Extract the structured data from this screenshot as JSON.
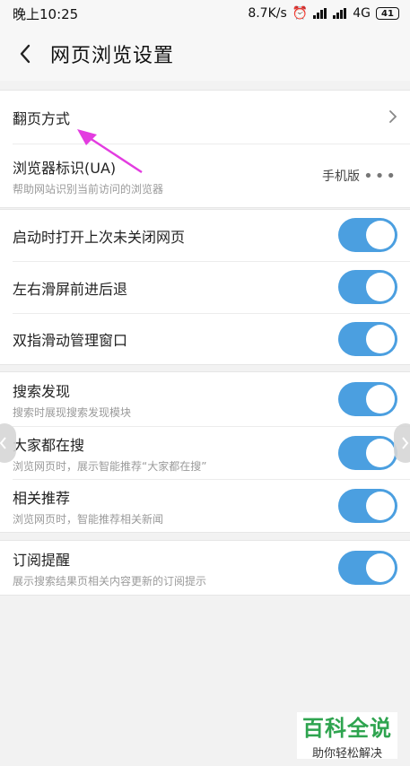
{
  "status": {
    "time": "晚上10:25",
    "speed": "8.7K/s",
    "network": "4G",
    "battery": "41",
    "icons": [
      "alarm-icon",
      "signal-icon",
      "signal-icon",
      "battery-icon"
    ]
  },
  "header": {
    "title": "网页浏览设置",
    "back_icon": "chevron-left-icon"
  },
  "section1": {
    "page_turn": {
      "label": "翻页方式"
    },
    "ua": {
      "label": "浏览器标识(UA)",
      "desc": "帮助网站识别当前访问的浏览器",
      "value": "手机版",
      "more": "•••"
    }
  },
  "section2": {
    "items": [
      {
        "label": "启动时打开上次未关闭网页",
        "on": true
      },
      {
        "label": "左右滑屏前进后退",
        "on": true
      },
      {
        "label": "双指滑动管理窗口",
        "on": true
      }
    ]
  },
  "section3": {
    "items": [
      {
        "label": "搜索发现",
        "desc": "搜索时展现搜索发现模块",
        "on": true
      },
      {
        "label": "大家都在搜",
        "desc": "浏览网页时，展示智能推荐“大家都在搜”",
        "on": true
      },
      {
        "label": "相关推荐",
        "desc": "浏览网页时，智能推荐相关新闻",
        "on": true
      }
    ]
  },
  "section4": {
    "items": [
      {
        "label": "订阅提醒",
        "desc": "展示搜索结果页相关内容更新的订阅提示",
        "on": true
      }
    ]
  },
  "watermark": {
    "line1": "百科全说",
    "line2": "助你轻松解决"
  },
  "colors": {
    "toggle_on": "#4b9fe0",
    "annotation_arrow": "#e33ce0"
  }
}
